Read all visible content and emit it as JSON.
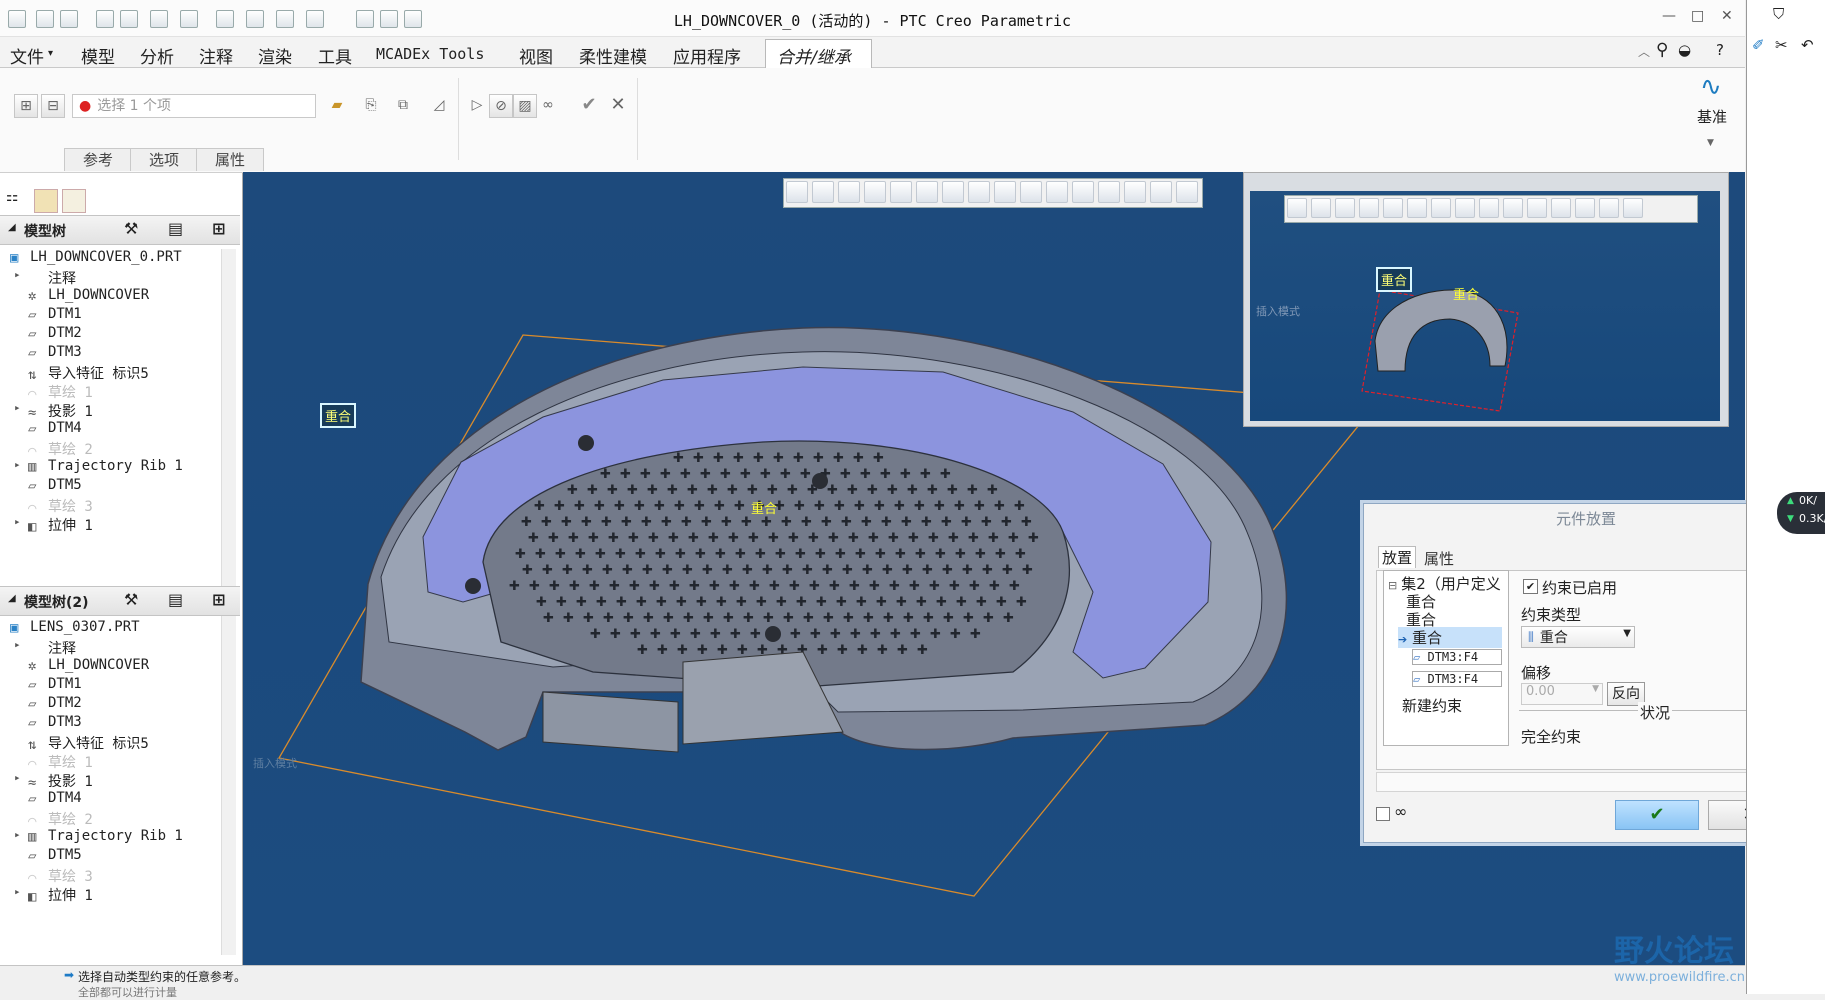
{
  "window": {
    "title": "LH_DOWNCOVER_0 (活动的) - PTC Creo Parametric"
  },
  "menubar": {
    "items": [
      "文件",
      "模型",
      "分析",
      "注释",
      "渲染",
      "工具",
      "MCADEx Tools",
      "视图",
      "柔性建模",
      "应用程序",
      "合并/继承"
    ],
    "active": "合并/继承"
  },
  "ribbon": {
    "select_placeholder": "选择 1 个项",
    "subtabs": [
      "参考",
      "选项",
      "属性"
    ],
    "datum_label": "基准"
  },
  "tree1": {
    "header": "模型树",
    "items": [
      {
        "label": "LH_DOWNCOVER_0.PRT",
        "dim": false
      },
      {
        "label": "注释",
        "dim": false
      },
      {
        "label": "LH_DOWNCOVER",
        "dim": false
      },
      {
        "label": "DTM1",
        "dim": false
      },
      {
        "label": "DTM2",
        "dim": false
      },
      {
        "label": "DTM3",
        "dim": false
      },
      {
        "label": "导入特征 标识5",
        "dim": false
      },
      {
        "label": "草绘 1",
        "dim": true
      },
      {
        "label": "投影 1",
        "dim": false
      },
      {
        "label": "DTM4",
        "dim": false
      },
      {
        "label": "草绘 2",
        "dim": true
      },
      {
        "label": "Trajectory Rib 1",
        "dim": false
      },
      {
        "label": "DTM5",
        "dim": false
      },
      {
        "label": "草绘 3",
        "dim": true
      },
      {
        "label": "拉伸 1",
        "dim": false
      }
    ]
  },
  "tree2": {
    "header": "模型树(2)",
    "items": [
      {
        "label": "LENS_0307.PRT",
        "dim": false
      },
      {
        "label": "注释",
        "dim": false
      },
      {
        "label": "LH_DOWNCOVER",
        "dim": false
      },
      {
        "label": "DTM1",
        "dim": false
      },
      {
        "label": "DTM2",
        "dim": false
      },
      {
        "label": "DTM3",
        "dim": false
      },
      {
        "label": "导入特征 标识5",
        "dim": false
      },
      {
        "label": "草绘 1",
        "dim": true
      },
      {
        "label": "投影 1",
        "dim": false
      },
      {
        "label": "DTM4",
        "dim": false
      },
      {
        "label": "草绘 2",
        "dim": true
      },
      {
        "label": "Trajectory Rib 1",
        "dim": false
      },
      {
        "label": "DTM5",
        "dim": false
      },
      {
        "label": "草绘 3",
        "dim": true
      },
      {
        "label": "拉伸 1",
        "dim": false
      }
    ]
  },
  "viewport": {
    "tags": [
      "重合",
      "重合"
    ],
    "mode_label": "插入模式"
  },
  "preview": {
    "tags": [
      "重合",
      "重合"
    ],
    "mode_label": "插入模式"
  },
  "dialog": {
    "title": "元件放置",
    "tabs": [
      "放置",
      "属性"
    ],
    "set_label": "集2（用户定义",
    "constraints": [
      "重合",
      "重合",
      "重合"
    ],
    "refs": [
      "DTM3:F4",
      "DTM3:F4"
    ],
    "new_constraint": "新建约束",
    "enabled_label": "约束已启用",
    "type_label": "约束类型",
    "type_value": "重合",
    "offset_label": "偏移",
    "offset_value": "0.00",
    "reverse_label": "反向",
    "status_label": "状况",
    "status_value": "完全约束"
  },
  "statusbar": {
    "line1": "选择自动类型约束的任意参考。",
    "line2": "全部都可以进行计量"
  },
  "netspeed": {
    "up": "0K/",
    "down": "0.3K/"
  },
  "watermark": {
    "title": "野火论坛",
    "url": "www.proewildfire.cn"
  },
  "colors": {
    "viewport_bg": "#1c4a7c",
    "model_surface": "#8a94a6",
    "selected_surface": "#8c94e6",
    "tag_text": "#ffff77"
  }
}
